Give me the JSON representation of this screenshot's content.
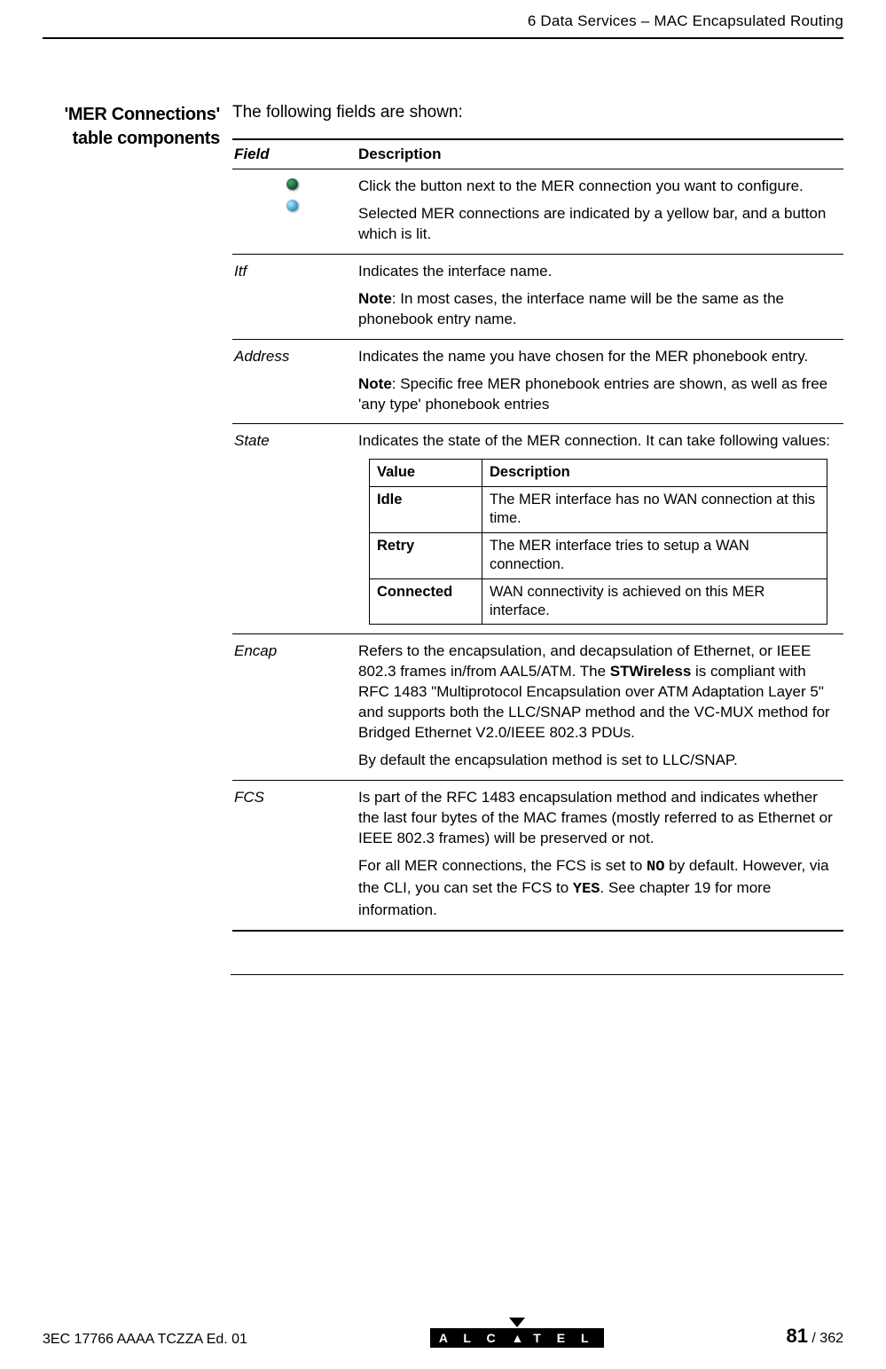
{
  "header": {
    "chapter": "6  Data Services – MAC Encapsulated Routing"
  },
  "sidebar": {
    "heading_l1": "'MER Connections'",
    "heading_l2": "table components"
  },
  "intro": "The following fields are shown:",
  "table": {
    "head_field": "Field",
    "head_desc": "Description",
    "rows": {
      "r0": {
        "desc_p1": "Click the button next to the MER connection you want to configure.",
        "desc_p2": "Selected MER connections are indicated by a yellow bar, and a button which is lit."
      },
      "r1": {
        "field": "Itf",
        "desc_p1": "Indicates the interface name.",
        "note_label": "Note",
        "desc_p2": ": In most cases, the interface name will be the same as the phonebook entry name."
      },
      "r2": {
        "field": "Address",
        "desc_p1": "Indicates the name you have chosen for the MER phonebook entry.",
        "note_label": "Note",
        "desc_p2": ": Specific free MER phonebook entries are shown, as well as free 'any type' phonebook entries"
      },
      "r3": {
        "field": "State",
        "desc_p1": "Indicates the state of the MER connection. It can take following values:",
        "inner": {
          "h_val": "Value",
          "h_desc": "Description",
          "v1": "Idle",
          "d1": "The MER interface has no WAN connection at this time.",
          "v2": "Retry",
          "d2": "The MER interface tries to setup a WAN connection.",
          "v3": "Connected",
          "d3": "WAN connectivity is achieved on this MER interface."
        }
      },
      "r4": {
        "field": "Encap",
        "desc_p1a": "Refers to the encapsulation, and decapsulation of Ethernet, or IEEE 802.3 frames in/from AAL5/ATM. The ",
        "desc_p1b": "STWireless",
        "desc_p1c": " is compliant with RFC 1483 \"Multiprotocol Encapsulation over ATM Adaptation Layer 5\" and supports both the LLC/SNAP method and the VC-MUX method for Bridged Ethernet V2.0/IEEE 802.3 PDUs.",
        "desc_p2": "By default the encapsulation method is set to LLC/SNAP."
      },
      "r5": {
        "field": "FCS",
        "desc_p1": "Is part of the RFC 1483 encapsulation method and indicates whether the last four bytes of the MAC frames (mostly referred to as Ethernet or IEEE 802.3 frames) will be preserved or not.",
        "desc_p2a": "For all MER connections, the FCS is set to ",
        "desc_p2b": "NO",
        "desc_p2c": " by default. However, via the CLI, you can set the FCS to ",
        "desc_p2d": "YES",
        "desc_p2e": ". See chapter 19 for more information."
      }
    }
  },
  "footer": {
    "left": "3EC 17766 AAAA TCZZA Ed. 01",
    "logo": "ALCATEL",
    "page_current": "81",
    "page_sep": " / ",
    "page_total": "362"
  }
}
